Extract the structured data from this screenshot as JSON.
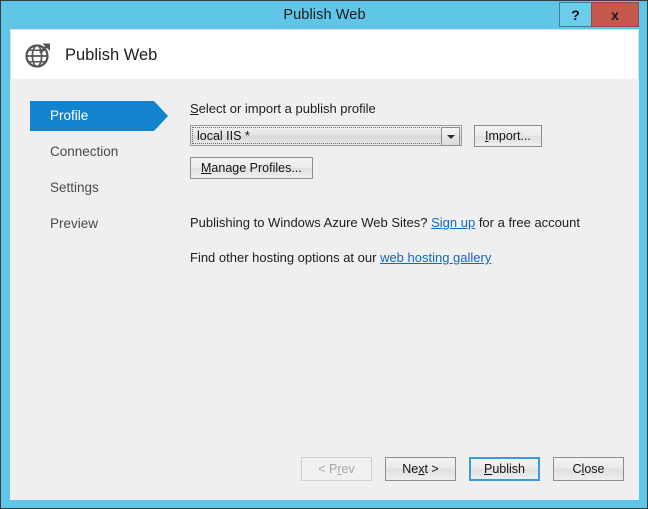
{
  "window": {
    "title": "Publish Web",
    "help_button": "?",
    "close_button": "x"
  },
  "header": {
    "title": "Publish Web",
    "icon": "globe-publish-icon"
  },
  "nav": {
    "items": [
      {
        "label": "Profile",
        "selected": true
      },
      {
        "label": "Connection",
        "selected": false
      },
      {
        "label": "Settings",
        "selected": false
      },
      {
        "label": "Preview",
        "selected": false
      }
    ]
  },
  "profile_panel": {
    "field_label_pre": "S",
    "field_label_rest": "elect or import a publish profile",
    "combo": {
      "value": "local IIS *",
      "options": [
        "local IIS *"
      ]
    },
    "import_button": {
      "acc": "I",
      "rest": "mport..."
    },
    "manage_button": {
      "acc": "M",
      "rest": "anage Profiles..."
    },
    "azure_line": {
      "before": "Publishing to Windows Azure Web Sites? ",
      "link": "Sign up",
      "after": " for a free account"
    },
    "hosting_line": {
      "before": "Find other hosting options at our ",
      "link": "web hosting gallery",
      "after": ""
    }
  },
  "footer": {
    "prev": {
      "pre": "< P",
      "acc": "r",
      "post": "ev"
    },
    "next": {
      "pre": "Ne",
      "acc": "x",
      "post": "t >"
    },
    "publish": {
      "pre": "",
      "acc": "P",
      "post": "ublish"
    },
    "close": {
      "pre": "C",
      "acc": "l",
      "post": "ose"
    }
  },
  "colors": {
    "title_bar": "#60c6e8",
    "close_button": "#c4584f",
    "nav_selected": "#1383cd",
    "link": "#1468bd",
    "default_button_border": "#3a9bdc",
    "content_bg": "#efefef"
  }
}
